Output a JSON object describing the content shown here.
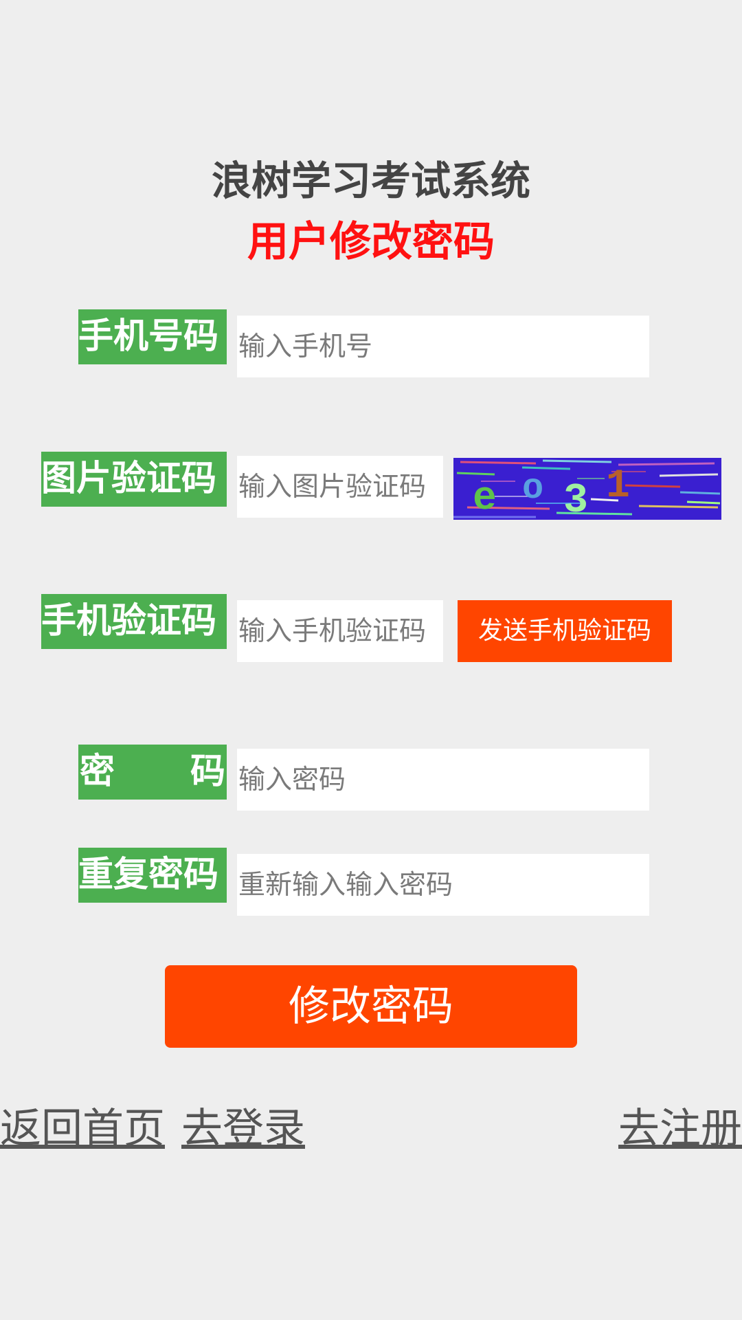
{
  "header": {
    "app_title": "浪树学习考试系统",
    "page_title": "用户修改密码"
  },
  "form": {
    "phone": {
      "label": "手机号码",
      "placeholder": "输入手机号",
      "value": ""
    },
    "image_code": {
      "label": "图片验证码",
      "placeholder": "输入图片验证码",
      "value": "",
      "captcha_text": "eo31"
    },
    "sms_code": {
      "label": "手机验证码",
      "placeholder": "输入手机验证码",
      "value": "",
      "send_button_label": "发送手机验证码"
    },
    "password": {
      "label_chars": [
        "密",
        "码"
      ],
      "placeholder": "输入密码",
      "value": ""
    },
    "repeat_password": {
      "label": "重复密码",
      "placeholder": "重新输入输入密码",
      "value": ""
    },
    "submit_label": "修改密码"
  },
  "footer": {
    "home_link": "返回首页",
    "login_link": "去登录",
    "register_link": "去注册"
  },
  "colors": {
    "background": "#eeeeee",
    "label_bg": "#4caf50",
    "accent_button": "#ff4500",
    "page_title": "#ff1111",
    "captcha_bg": "#3a1fd0"
  }
}
